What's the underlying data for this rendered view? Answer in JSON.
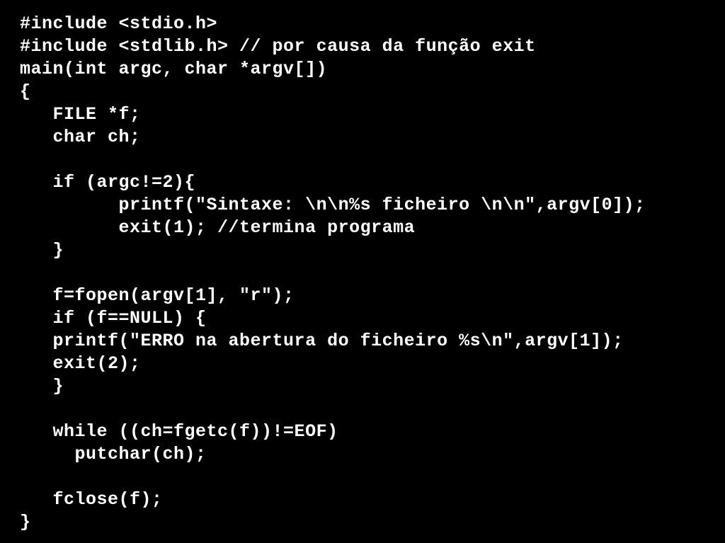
{
  "code": {
    "lines": [
      "#include <stdio.h>",
      "#include <stdlib.h> // por causa da função exit",
      "main(int argc, char *argv[])",
      "{",
      "   FILE *f;",
      "   char ch;",
      "",
      "   if (argc!=2){",
      "         printf(\"Sintaxe: \\n\\n%s ficheiro \\n\\n\",argv[0]);",
      "         exit(1); //termina programa",
      "   }",
      "",
      "   f=fopen(argv[1], \"r\");",
      "   if (f==NULL) {",
      "   printf(\"ERRO na abertura do ficheiro %s\\n\",argv[1]);",
      "   exit(2);",
      "   }",
      "",
      "   while ((ch=fgetc(f))!=EOF)",
      "     putchar(ch);",
      "",
      "   fclose(f);",
      "}"
    ]
  },
  "colors": {
    "background": "#000000",
    "text": "#ffffff"
  }
}
